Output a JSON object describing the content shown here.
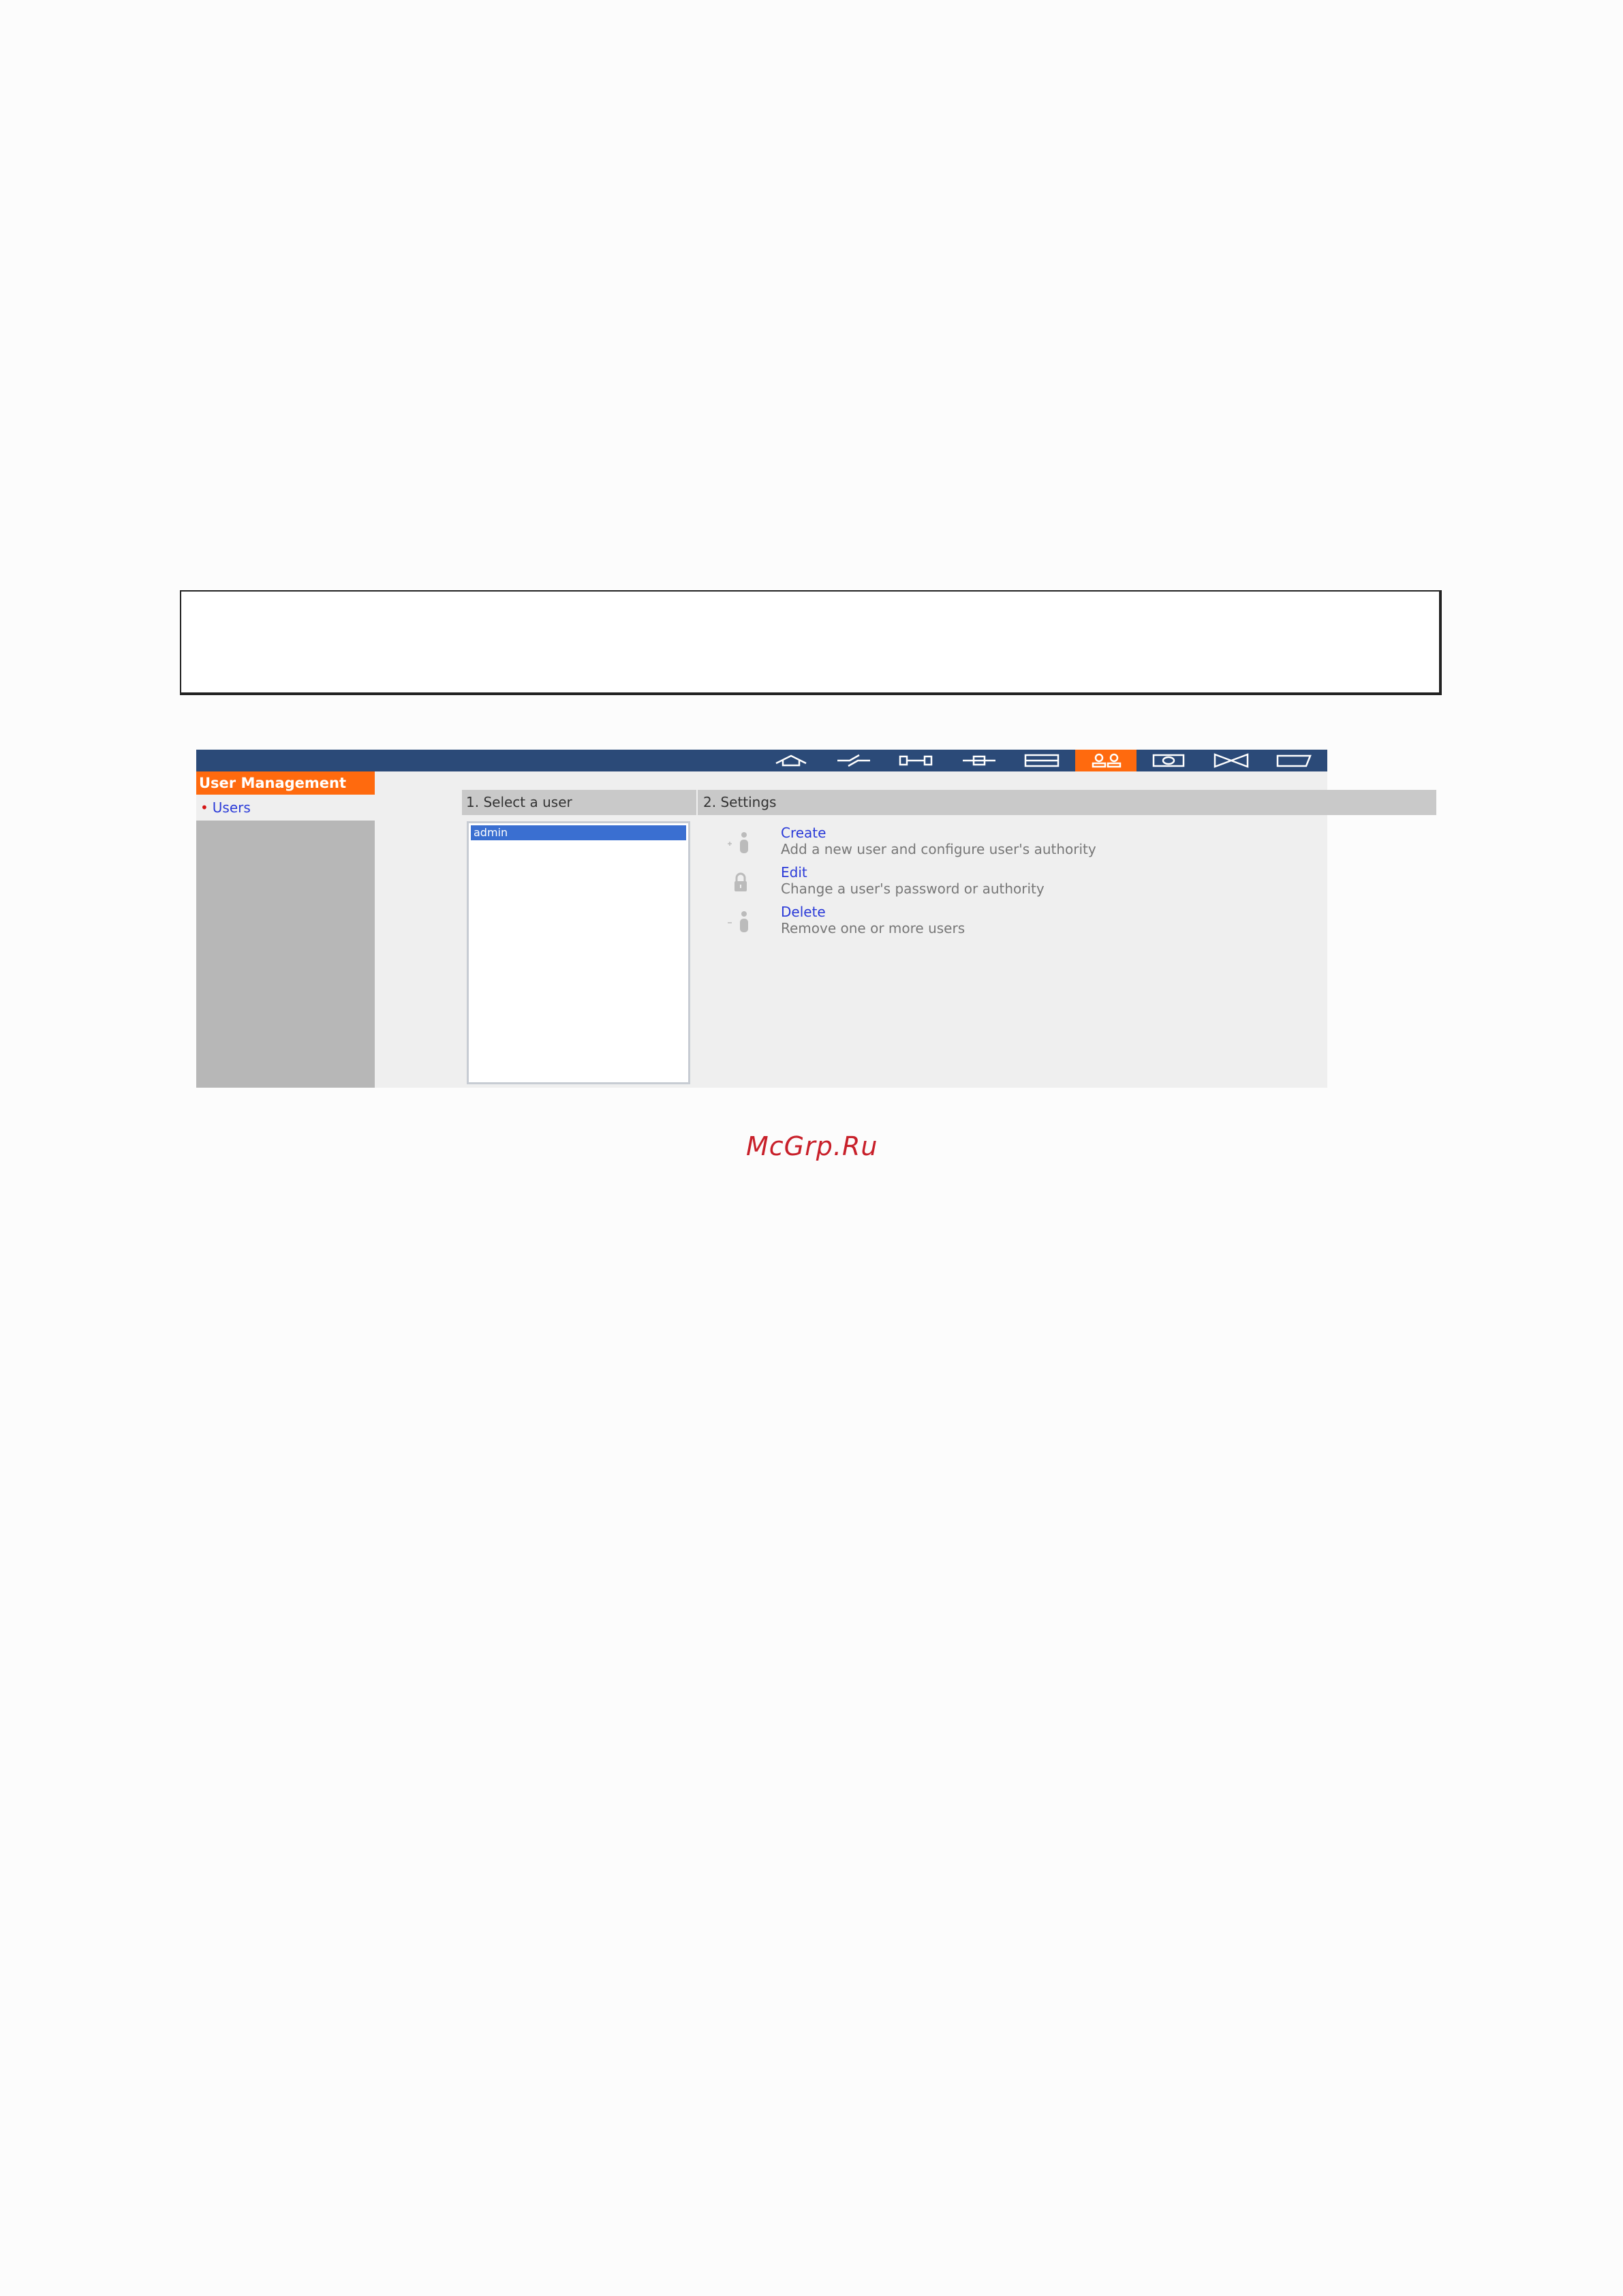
{
  "app": {
    "sidebar": {
      "title": "User Management",
      "items": [
        {
          "label": "Users",
          "bullet": "•"
        }
      ]
    },
    "nav_icons": [
      "home-icon",
      "power-icon",
      "network-icon",
      "plug-icon",
      "storage-icon",
      "users-icon",
      "camera-icon",
      "media-icon",
      "tag-icon"
    ],
    "active_nav": "users-icon",
    "colors": {
      "topbar": "#2b4a78",
      "accent": "#ff6a0e",
      "link": "#2a3ad8",
      "selection": "#3a6fd1"
    },
    "select_panel": {
      "title": "1. Select a user",
      "users": [
        "admin"
      ],
      "selected": "admin"
    },
    "settings_panel": {
      "title": "2. Settings",
      "actions": [
        {
          "label": "Create",
          "description": "Add a new user and configure user's authority",
          "icon": "add-user-icon"
        },
        {
          "label": "Edit",
          "description": "Change a user's password or authority",
          "icon": "lock-icon"
        },
        {
          "label": "Delete",
          "description": "Remove one or more users",
          "icon": "remove-user-icon"
        }
      ]
    }
  },
  "watermark": "McGrp.Ru"
}
